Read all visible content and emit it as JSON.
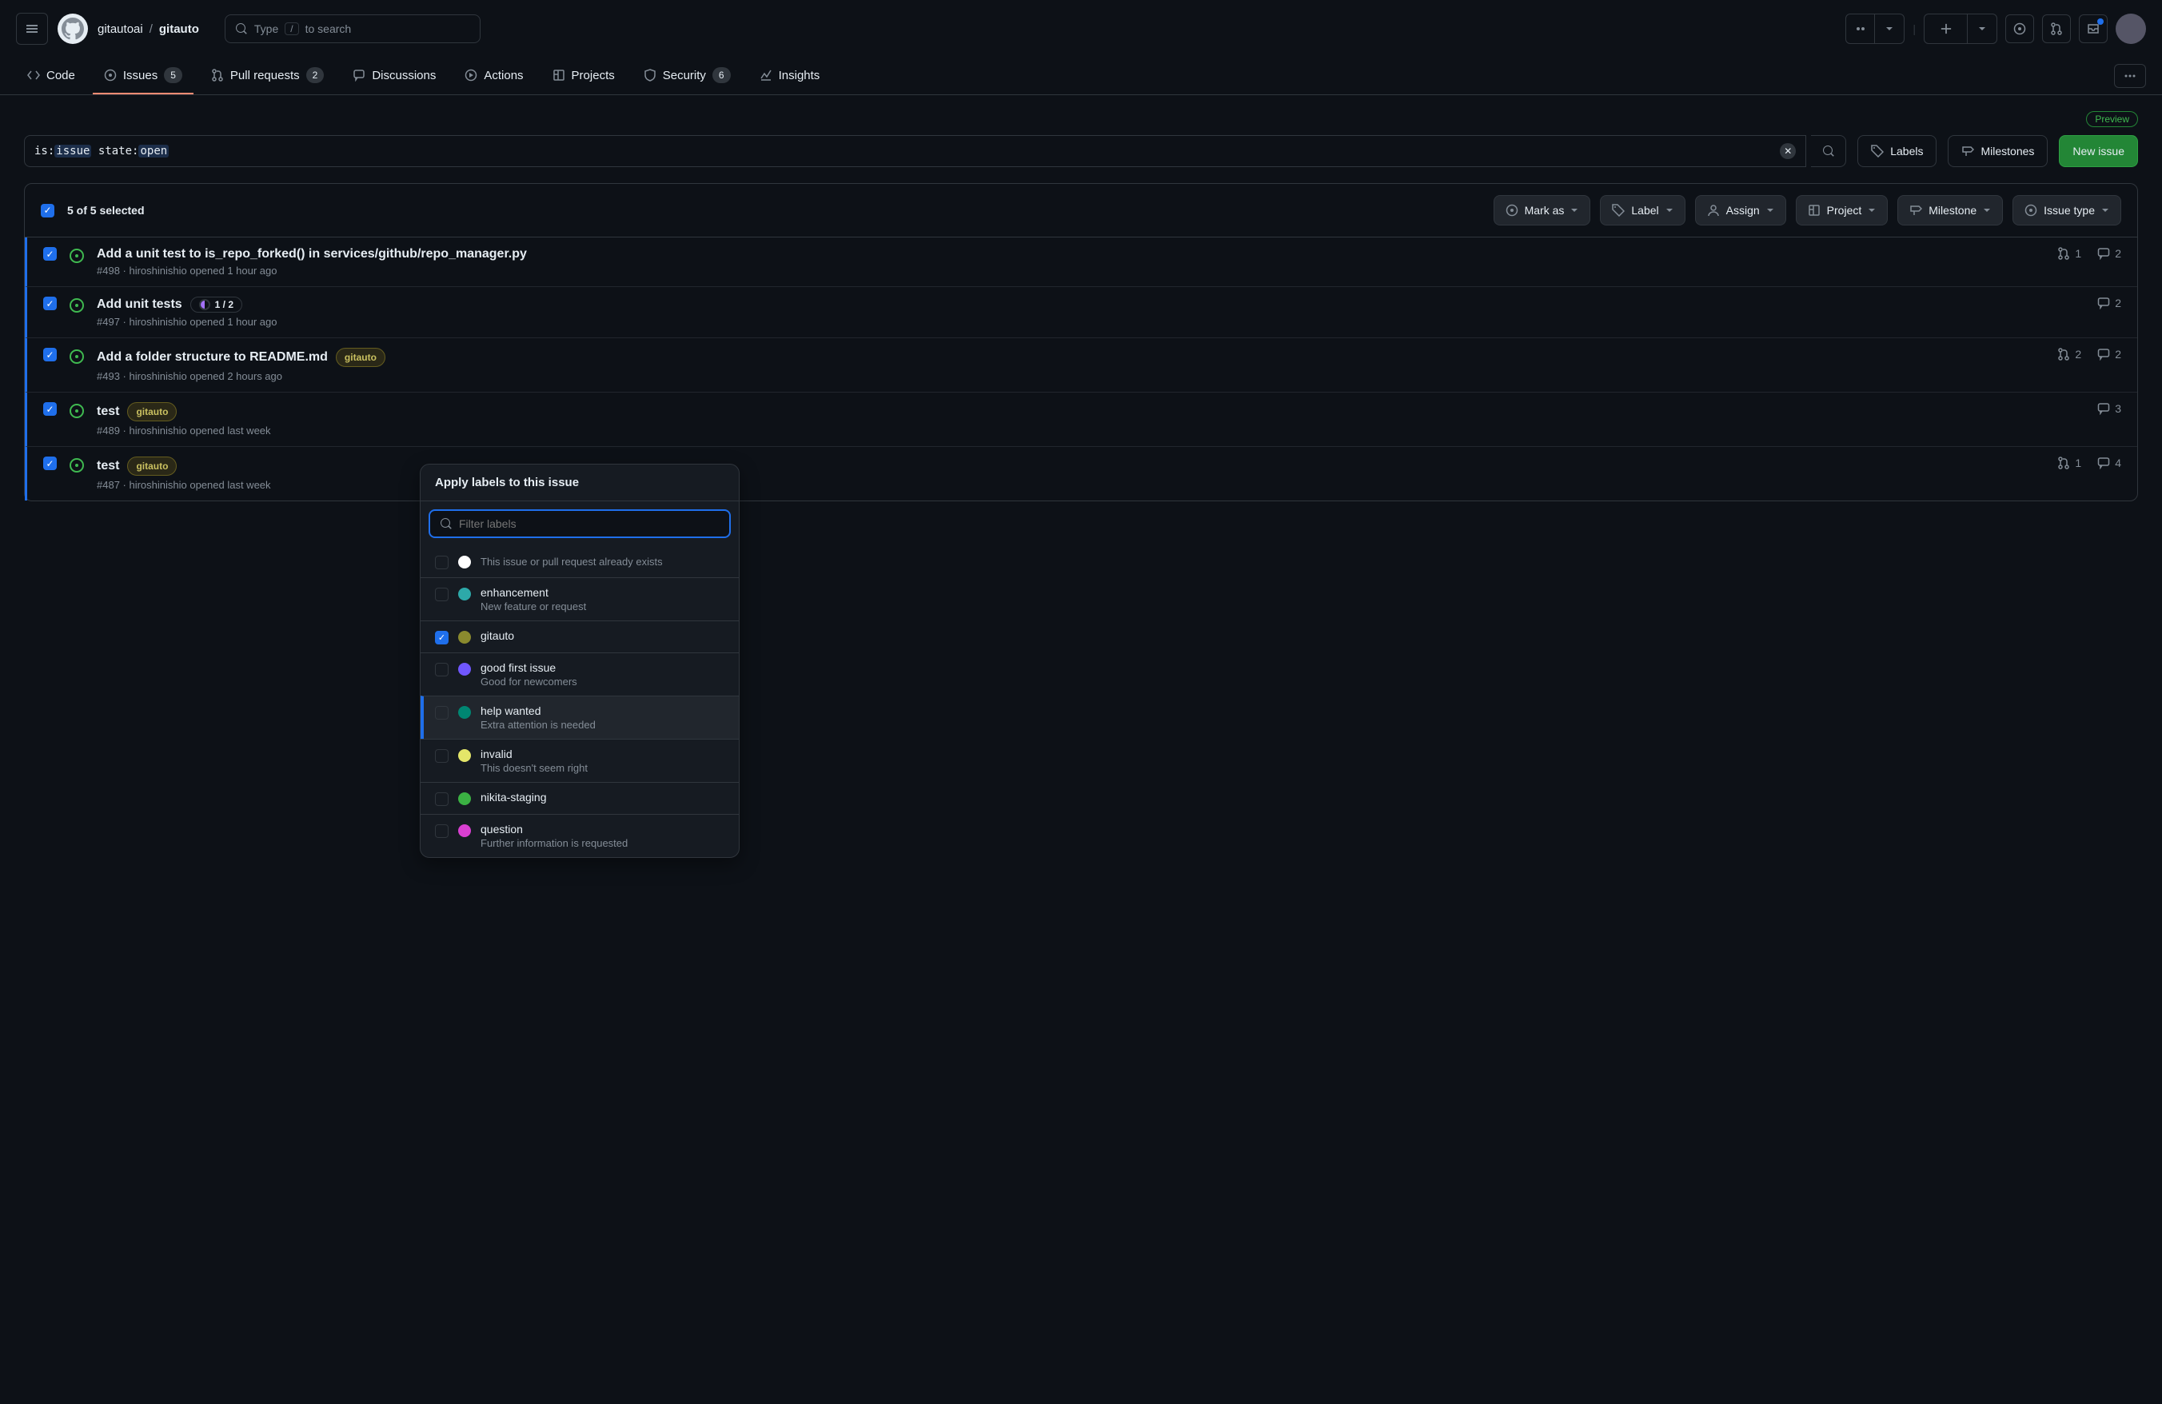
{
  "header": {
    "owner": "gitautoai",
    "repo": "gitauto",
    "search_placeholder": "Type",
    "search_hint": "to search"
  },
  "nav": {
    "code": "Code",
    "issues": "Issues",
    "issues_count": "5",
    "pulls": "Pull requests",
    "pulls_count": "2",
    "discussions": "Discussions",
    "actions": "Actions",
    "projects": "Projects",
    "security": "Security",
    "security_count": "6",
    "insights": "Insights"
  },
  "preview_label": "Preview",
  "filter": {
    "prefix_is": "is:",
    "val_is": "issue",
    "prefix_state": "state:",
    "val_state": "open"
  },
  "toolbar": {
    "labels": "Labels",
    "milestones": "Milestones",
    "new_issue": "New issue"
  },
  "list_header": {
    "selected_text": "5 of 5 selected",
    "mark_as": "Mark as",
    "label": "Label",
    "assign": "Assign",
    "project": "Project",
    "milestone": "Milestone",
    "issue_type": "Issue type"
  },
  "issues": [
    {
      "title": "Add a unit test to is_repo_forked() in services/github/repo_manager.py",
      "meta": "#498 · hiroshinishio opened 1 hour ago",
      "pr_count": "1",
      "comment_count": "2"
    },
    {
      "title": "Add unit tests",
      "progress": "1 / 2",
      "meta": "#497 · hiroshinishio opened 1 hour ago",
      "comment_count": "2"
    },
    {
      "title": "Add a folder structure to README.md",
      "meta": "#493 · hiroshinishio opened 2 hours ago",
      "pr_count": "2",
      "comment_count": "2",
      "label": "gitauto"
    },
    {
      "title": "test",
      "label": "gitauto",
      "meta": "#489 · hiroshinishio opened last week",
      "comment_count": "3"
    },
    {
      "title": "test",
      "label": "gitauto",
      "meta": "#487 · hiroshinishio opened last week",
      "pr_count": "1",
      "comment_count": "4"
    }
  ],
  "popover": {
    "title": "Apply labels to this issue",
    "placeholder": "Filter labels",
    "items": [
      {
        "name": "",
        "desc": "This issue or pull request already exists",
        "color": "#ffffff",
        "checked": false
      },
      {
        "name": "enhancement",
        "desc": "New feature or request",
        "color": "#2da9a9",
        "checked": false
      },
      {
        "name": "gitauto",
        "desc": "",
        "color": "#8a8a2e",
        "checked": true
      },
      {
        "name": "good first issue",
        "desc": "Good for newcomers",
        "color": "#7057ff",
        "checked": false
      },
      {
        "name": "help wanted",
        "desc": "Extra attention is needed",
        "color": "#008672",
        "checked": false,
        "highlighted": true
      },
      {
        "name": "invalid",
        "desc": "This doesn't seem right",
        "color": "#e4e669",
        "checked": false
      },
      {
        "name": "nikita-staging",
        "desc": "",
        "color": "#3bb143",
        "checked": false
      },
      {
        "name": "question",
        "desc": "Further information is requested",
        "color": "#d93fd1",
        "checked": false
      }
    ]
  },
  "colors": {
    "gitauto_label_border": "#645c1f",
    "gitauto_label_text": "#c9c060",
    "gitauto_label_bg": "#2a2817"
  }
}
